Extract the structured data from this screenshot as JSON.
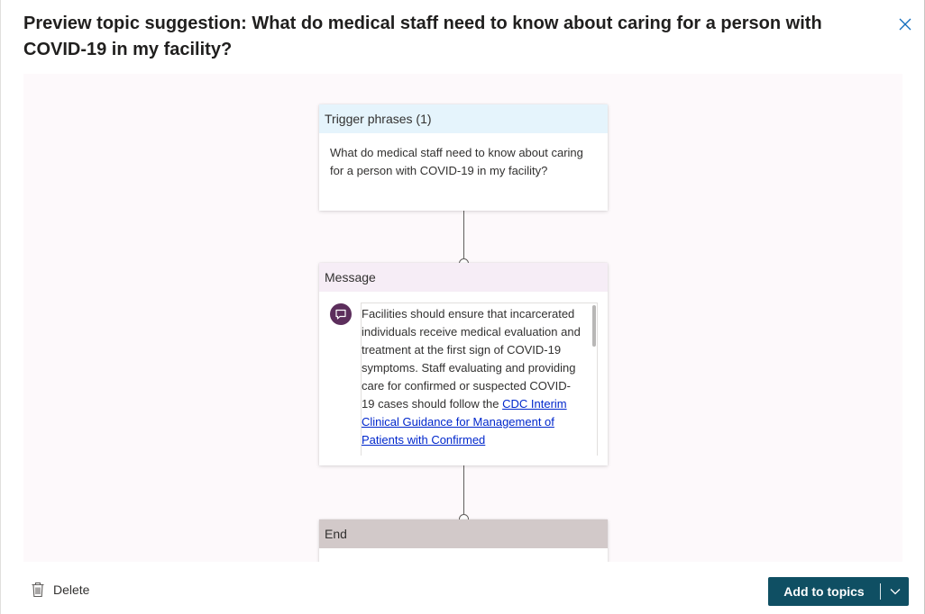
{
  "dialog": {
    "title": "Preview topic suggestion: What do medical staff need to know about caring for a person with COVID-19 in my facility?",
    "close_icon": "close-icon"
  },
  "trigger": {
    "header": "Trigger phrases (1)",
    "phrase": "What do medical staff need to know about caring for a person with COVID-19 in my facility?"
  },
  "message": {
    "header": "Message",
    "icon": "chat-bubble-icon",
    "text": "Facilities should ensure that incarcerated individuals receive medical evaluation and treatment at the first sign of COVID-19 symptoms. Staff evaluating and providing care for confirmed or suspected COVID-19 cases should follow the",
    "link_text": "CDC Interim Clinical Guidance for Management of Patients with Confirmed"
  },
  "end": {
    "header": "End"
  },
  "footer": {
    "delete_label": "Delete",
    "delete_icon": "trash-icon",
    "add_label": "Add to topics",
    "dropdown_icon": "chevron-down-icon"
  },
  "colors": {
    "primary": "#0f4f63",
    "trigger_header": "#e5f4fc",
    "message_header": "#f6edf6",
    "end_header": "#d2c9c9",
    "message_icon": "#5c2e5c",
    "link": "#0027cc"
  }
}
